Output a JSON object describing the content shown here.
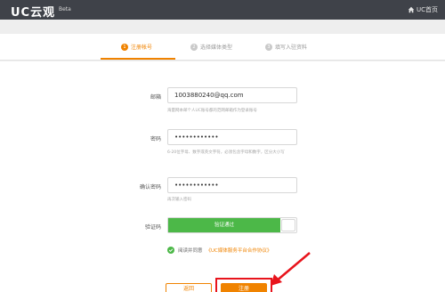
{
  "app": {
    "logo": "UC云观",
    "beta": "Beta",
    "home_label": "UC首页"
  },
  "steps": [
    {
      "num": "1",
      "label": "注册帐号"
    },
    {
      "num": "2",
      "label": "选择媒体类型"
    },
    {
      "num": "3",
      "label": "填写入驻资料"
    }
  ],
  "form": {
    "email": {
      "label": "邮箱",
      "value": "1003880240@qq.com",
      "hint": "海量网本邮个人UC账号都的范网邮箱作为登录账号"
    },
    "password": {
      "label": "密码",
      "value": "••••••••••••",
      "hint": "6-20位字母、数字或英文字符，必须包含字母和数字，区分大小写"
    },
    "confirm": {
      "label": "确认密码",
      "value": "••••••••••••",
      "hint": "再次输入密码"
    },
    "captcha": {
      "label": "验证码",
      "value": "验证通过"
    },
    "agree": {
      "text": "阅读并同意",
      "link": "《UC媒体服务平台合作协议》"
    }
  },
  "buttons": {
    "back": "返回",
    "register": "注册"
  },
  "colors": {
    "accent": "#f08300",
    "success": "#4cb848",
    "annotation": "#e8141c",
    "topbar": "#3f4249"
  }
}
